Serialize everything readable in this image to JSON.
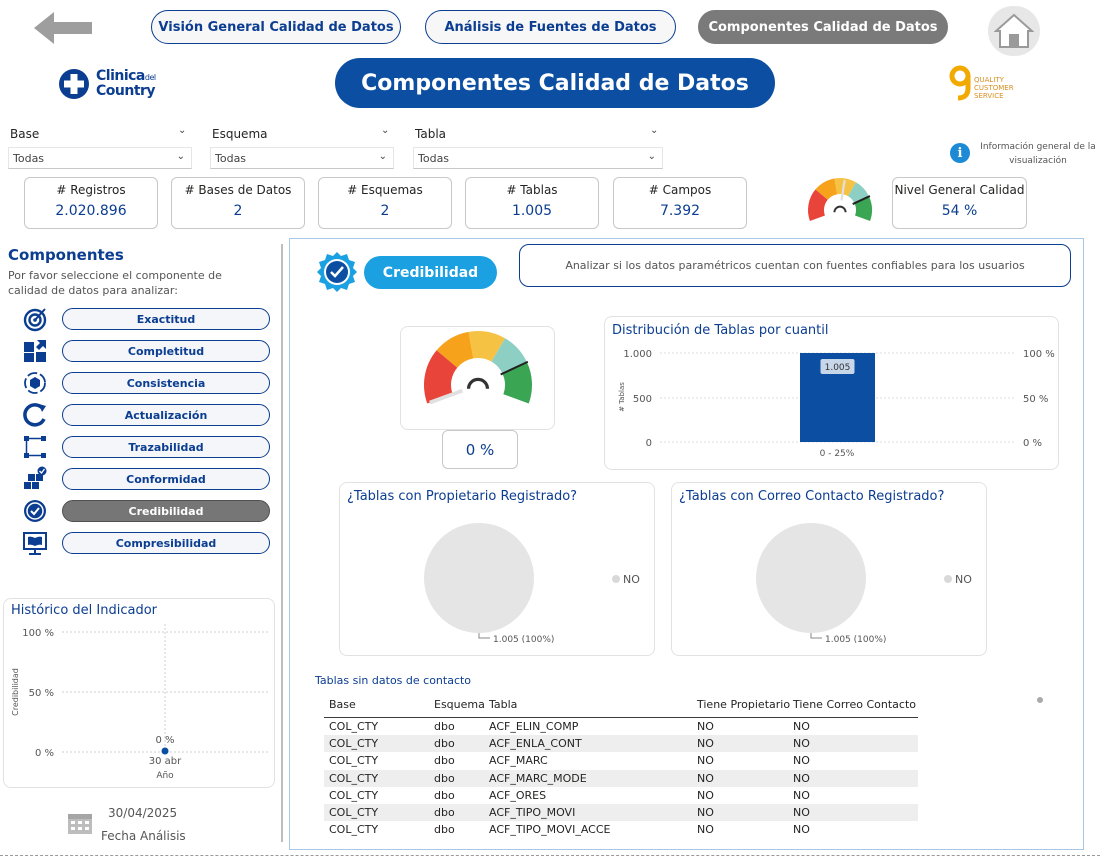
{
  "nav": {
    "tab1": "Visión General Calidad de Datos",
    "tab2": "Análisis de Fuentes de Datos",
    "tab3": "Componentes Calidad de Datos"
  },
  "page_title": "Componentes Calidad de Datos",
  "logos": {
    "clinica_line1": "Clinica",
    "clinica_del": "del",
    "clinica_line2": "Country",
    "qcs": [
      "QUALITY",
      "CUSTOMER",
      "SERVICE"
    ]
  },
  "filters": [
    {
      "label": "Base",
      "value": "Todas"
    },
    {
      "label": "Esquema",
      "value": "Todas"
    },
    {
      "label": "Tabla",
      "value": "Todas"
    }
  ],
  "info_text": "Información general de la visualización",
  "kpis": [
    {
      "label": "# Registros",
      "value": "2.020.896"
    },
    {
      "label": "# Bases de Datos",
      "value": "2"
    },
    {
      "label": "# Esquemas",
      "value": "2"
    },
    {
      "label": "# Tablas",
      "value": "1.005"
    },
    {
      "label": "# Campos",
      "value": "7.392"
    }
  ],
  "nivel_general": {
    "label": "Nivel General Calidad",
    "value": "54 %",
    "gauge_fraction": 0.54
  },
  "componentes": {
    "title": "Componentes",
    "subtitle": "Por favor seleccione el componente de calidad de datos para analizar:",
    "items": [
      {
        "label": "Exactitud",
        "icon": "target-icon",
        "active": false
      },
      {
        "label": "Completitud",
        "icon": "puzzle-icon",
        "active": false
      },
      {
        "label": "Consistencia",
        "icon": "cube-cycle-icon",
        "active": false
      },
      {
        "label": "Actualización",
        "icon": "refresh-icon",
        "active": false
      },
      {
        "label": "Trazabilidad",
        "icon": "flow-icon",
        "active": false
      },
      {
        "label": "Conformidad",
        "icon": "boxes-check-icon",
        "active": false
      },
      {
        "label": "Credibilidad",
        "icon": "badge-check-icon",
        "active": true
      },
      {
        "label": "Compresibilidad",
        "icon": "book-screen-icon",
        "active": false
      }
    ]
  },
  "historico": {
    "title": "Histórico del Indicador",
    "y_ticks": [
      "100 %",
      "50 %",
      "0 %"
    ],
    "ylabel": "Credibilidad",
    "point_label": "0 %",
    "x_tick": "30 abr",
    "xlabel": "Año"
  },
  "fecha": {
    "value": "30/04/2025",
    "label": "Fecha Análisis"
  },
  "componente_actual": {
    "label": "Credibilidad",
    "description": "Analizar si los datos paramétricos cuentan con fuentes confiables para los usuarios"
  },
  "gauge_main": {
    "value": "0 %",
    "fraction": 0.0
  },
  "chart_data": [
    {
      "type": "bar",
      "title": "Distribución de Tablas por cuantil",
      "categories": [
        "0 - 25%"
      ],
      "values": [
        1005
      ],
      "data_labels": [
        "1.005"
      ],
      "ylabel": "# Tablas",
      "y_ticks": [
        "1.000",
        "500",
        "0"
      ],
      "y2_ticks": [
        "100 %",
        "50 %",
        "0 %"
      ],
      "ylim": [
        0,
        1000
      ],
      "color": "#0b4ea2"
    },
    {
      "type": "pie",
      "title": "¿Tablas con Propietario Registrado?",
      "categories": [
        "NO"
      ],
      "values": [
        1005
      ],
      "data_label": "1.005 (100%)"
    },
    {
      "type": "pie",
      "title": "¿Tablas con Correo Contacto Registrado?",
      "categories": [
        "NO"
      ],
      "values": [
        1005
      ],
      "data_label": "1.005 (100%)"
    }
  ],
  "tabla": {
    "title": "Tablas sin datos de contacto",
    "headers": [
      "Base",
      "Esquema",
      "Tabla",
      "Tiene Propietario",
      "Tiene Correo Contacto"
    ],
    "rows": [
      [
        "COL_CTY",
        "dbo",
        "ACF_ELIN_COMP",
        "NO",
        "NO"
      ],
      [
        "COL_CTY",
        "dbo",
        "ACF_ENLA_CONT",
        "NO",
        "NO"
      ],
      [
        "COL_CTY",
        "dbo",
        "ACF_MARC",
        "NO",
        "NO"
      ],
      [
        "COL_CTY",
        "dbo",
        "ACF_MARC_MODE",
        "NO",
        "NO"
      ],
      [
        "COL_CTY",
        "dbo",
        "ACF_ORES",
        "NO",
        "NO"
      ],
      [
        "COL_CTY",
        "dbo",
        "ACF_TIPO_MOVI",
        "NO",
        "NO"
      ],
      [
        "COL_CTY",
        "dbo",
        "ACF_TIPO_MOVI_ACCE",
        "NO",
        "NO"
      ]
    ]
  },
  "colors": {
    "brand_blue": "#0b4ea2",
    "accent_cyan": "#1ba1e2",
    "gauge_red": "#e8443a",
    "gauge_orange": "#f7a21b",
    "gauge_yellow": "#f6c244",
    "gauge_teal": "#8ecfc4",
    "gauge_green": "#3aa654"
  }
}
